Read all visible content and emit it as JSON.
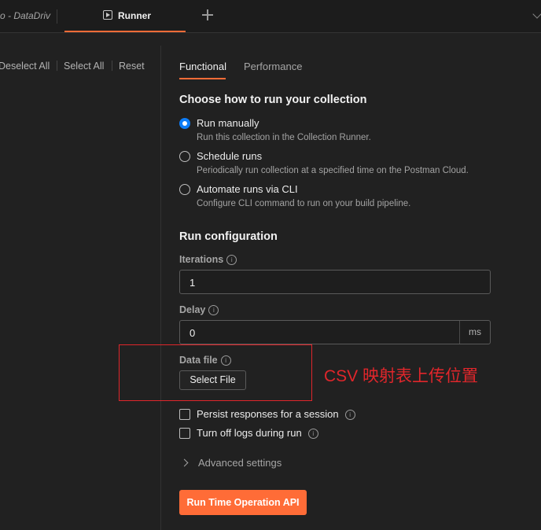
{
  "tabs_bar": {
    "prev_tab_label": "o - DataDriv",
    "active_tab_label": "Runner"
  },
  "left_panel": {
    "deselect_all": "Deselect All",
    "select_all": "Select All",
    "reset": "Reset"
  },
  "runner_tabs": [
    {
      "label": "Functional",
      "active": true
    },
    {
      "label": "Performance",
      "active": false
    }
  ],
  "run_mode": {
    "heading": "Choose how to run your collection",
    "options": [
      {
        "label": "Run manually",
        "description": "Run this collection in the Collection Runner.",
        "selected": true
      },
      {
        "label": "Schedule runs",
        "description": "Periodically run collection at a specified time on the Postman Cloud.",
        "selected": false
      },
      {
        "label": "Automate runs via CLI",
        "description": "Configure CLI command to run on your build pipeline.",
        "selected": false
      }
    ]
  },
  "run_config": {
    "heading": "Run configuration",
    "iterations_label": "Iterations",
    "iterations_value": "1",
    "delay_label": "Delay",
    "delay_value": "0",
    "delay_unit": "ms",
    "data_file_label": "Data file",
    "select_file_label": "Select File",
    "persist_label": "Persist responses for a session",
    "persist_checked": false,
    "logs_label": "Turn off logs during run",
    "logs_checked": false,
    "advanced_label": "Advanced settings",
    "run_button_label": "Run Time Operation API"
  },
  "annotation": {
    "text": "CSV 映射表上传位置",
    "color": "#e0262b"
  },
  "colors": {
    "accent": "#ff6c37",
    "radio_selected": "#0d7df7",
    "background": "#212121"
  }
}
